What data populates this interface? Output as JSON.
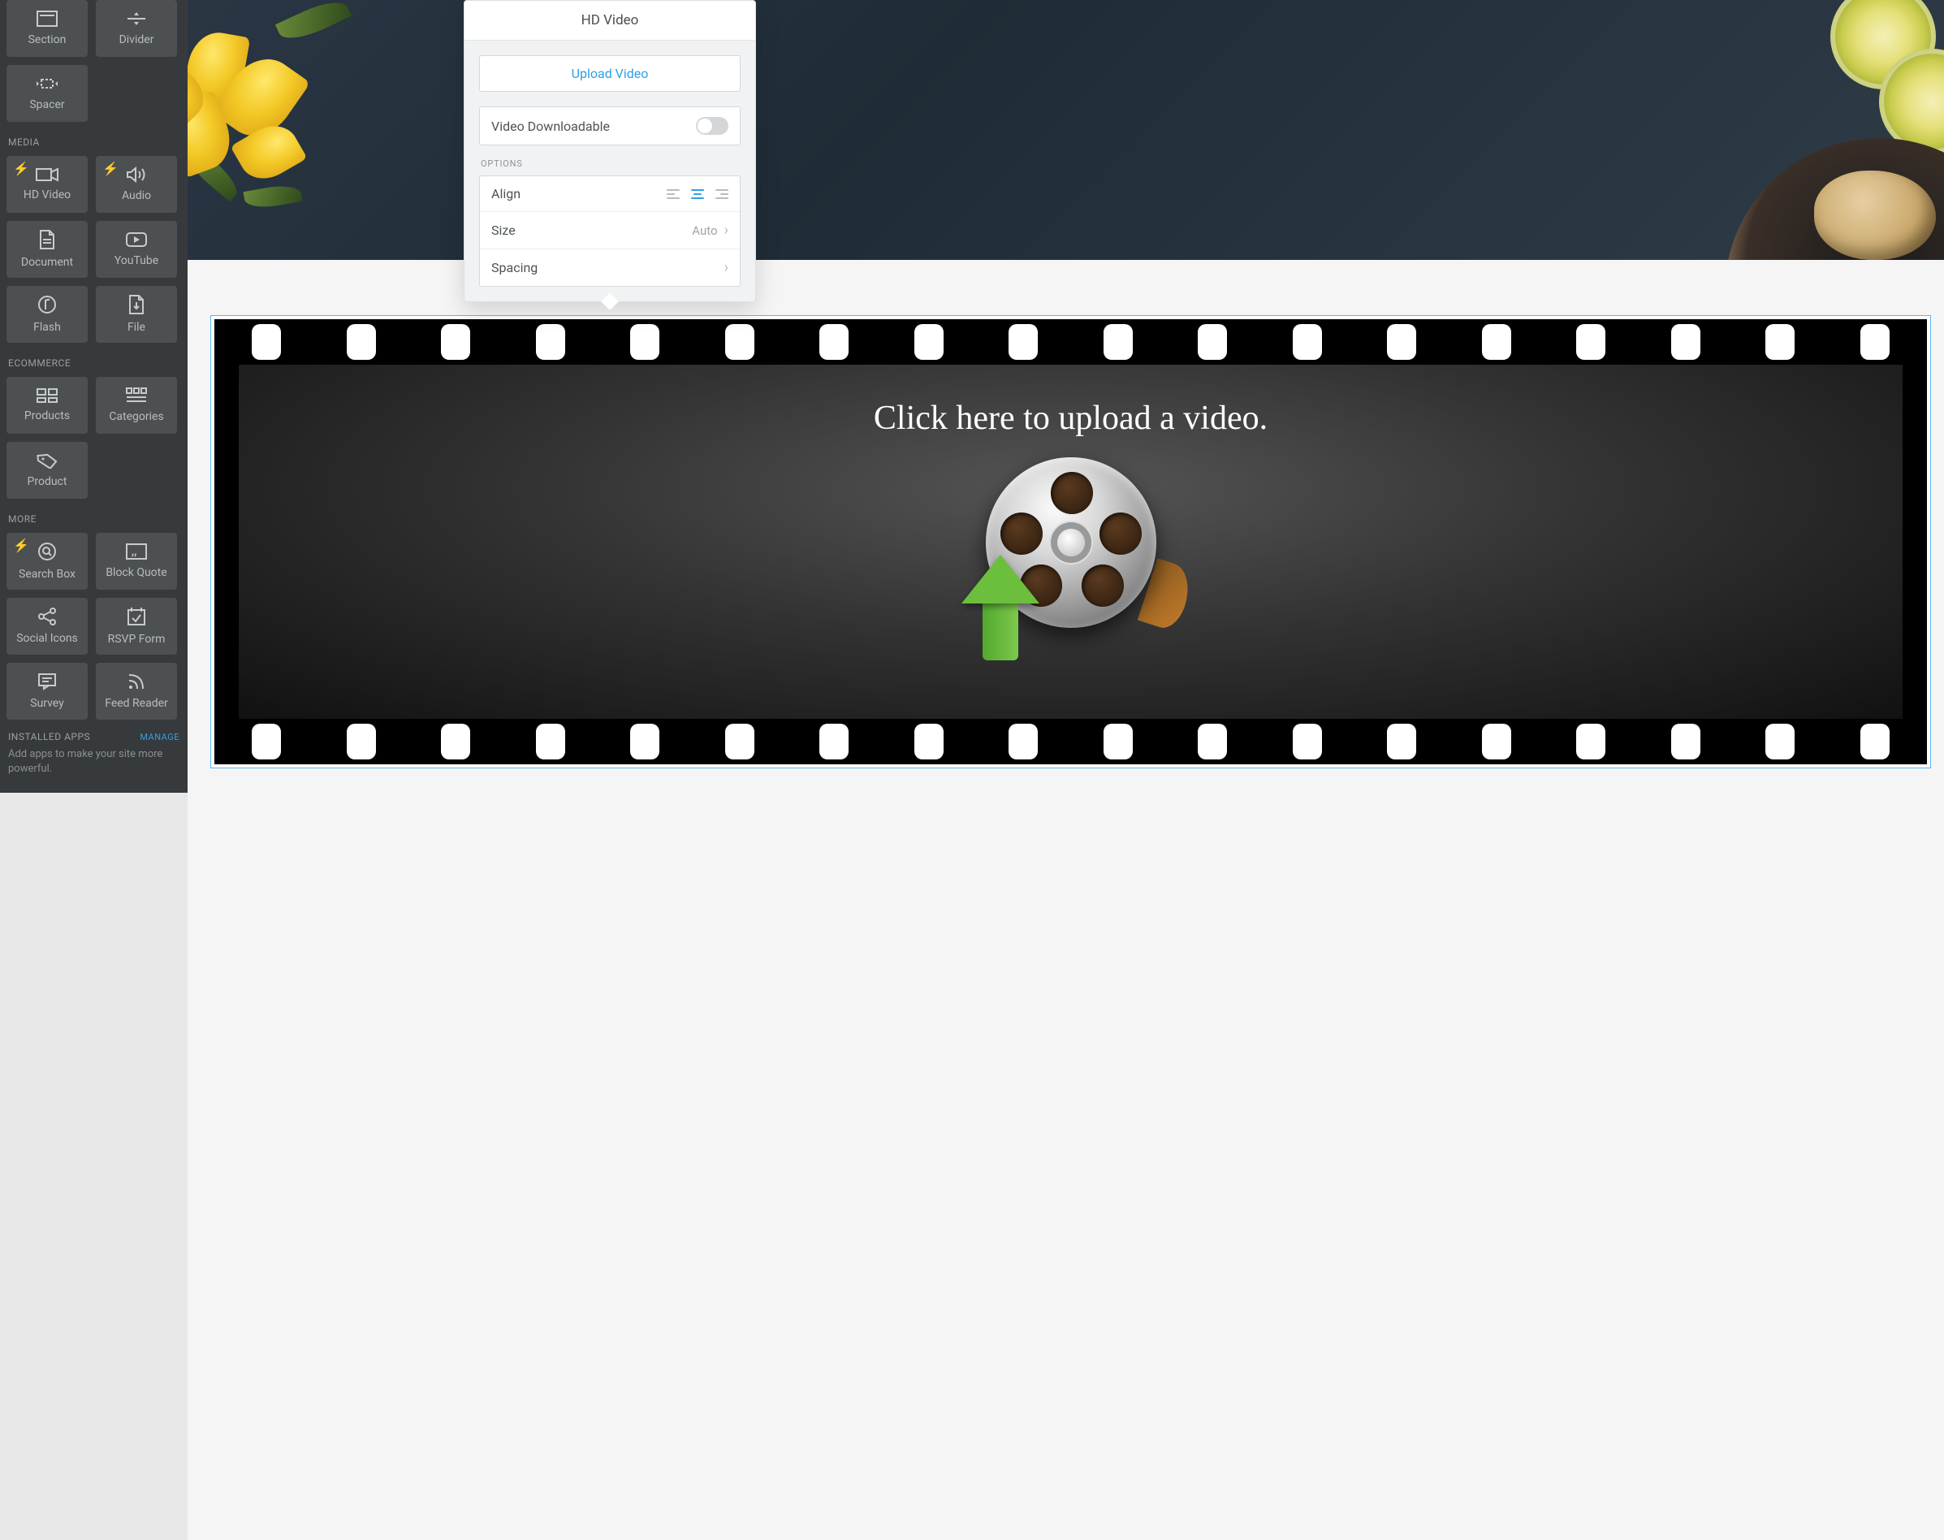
{
  "sidebar": {
    "structure_items": [
      {
        "label": "Section"
      },
      {
        "label": "Divider"
      },
      {
        "label": "Spacer"
      }
    ],
    "media_header": "MEDIA",
    "media_items": [
      {
        "label": "HD Video",
        "lightning": true
      },
      {
        "label": "Audio",
        "lightning": true
      },
      {
        "label": "Document"
      },
      {
        "label": "YouTube"
      },
      {
        "label": "Flash"
      },
      {
        "label": "File"
      }
    ],
    "ecommerce_header": "ECOMMERCE",
    "ecommerce_items": [
      {
        "label": "Products"
      },
      {
        "label": "Categories"
      },
      {
        "label": "Product"
      }
    ],
    "more_header": "MORE",
    "more_items": [
      {
        "label": "Search Box",
        "lightning": true
      },
      {
        "label": "Block Quote"
      },
      {
        "label": "Social Icons"
      },
      {
        "label": "RSVP Form"
      },
      {
        "label": "Survey"
      },
      {
        "label": "Feed Reader"
      }
    ],
    "installed_apps_label": "INSTALLED APPS",
    "manage_label": "MANAGE",
    "apps_desc": "Add apps to make your site more powerful."
  },
  "popup": {
    "title": "HD Video",
    "upload_label": "Upload Video",
    "downloadable_label": "Video Downloadable",
    "options_label": "OPTIONS",
    "align_label": "Align",
    "size_label": "Size",
    "size_value": "Auto",
    "spacing_label": "Spacing"
  },
  "video_block": {
    "prompt_text": "Click here to upload a video."
  }
}
